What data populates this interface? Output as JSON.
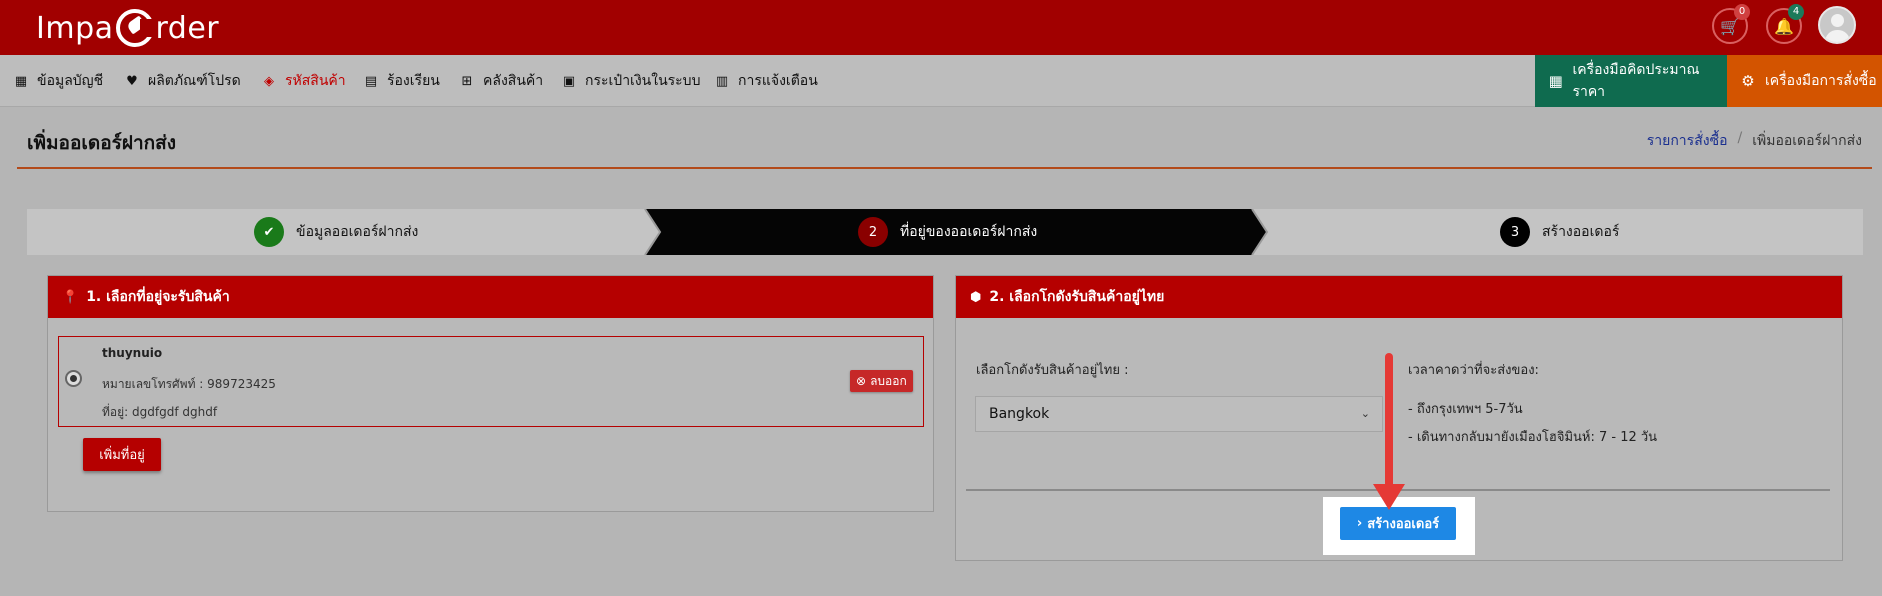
{
  "header": {
    "logo_text_left": "Impa",
    "logo_text_right": "rder",
    "cart_badge": "0",
    "notif_badge": "4",
    "colors": {
      "bar": "#a10000",
      "cart_badge": "#d04040",
      "notif_badge": "#1b7a5a"
    }
  },
  "nav": {
    "items": [
      {
        "label": "ข้อมูลบัญชี",
        "icon": "dashboard-icon"
      },
      {
        "label": "ผลิตภัณฑ์โปรด",
        "icon": "heart-icon"
      },
      {
        "label": "รหัสสินค้า",
        "icon": "layers-icon"
      },
      {
        "label": "ร้องเรียน",
        "icon": "comment-icon"
      },
      {
        "label": "คลังสินค้า",
        "icon": "warehouse-icon"
      },
      {
        "label": "กระเป๋าเงินในระบบ",
        "icon": "wallet-icon"
      },
      {
        "label": "การแจ้งเตือน",
        "icon": "book-icon"
      }
    ],
    "tools": [
      {
        "label": "เครื่องมือคิดประมาณราคา",
        "icon": "calculator-icon",
        "color": "#0f6b4f"
      },
      {
        "label": "เครื่องมือการสั่งซื้อ",
        "icon": "gear-icon",
        "color": "#d35400"
      }
    ]
  },
  "page": {
    "title": "เพิ่มออเดอร์ฝากส่ง",
    "breadcrumb_link": "รายการสั่งซื้อ",
    "breadcrumb_sep": "/",
    "breadcrumb_current": "เพิ่มออเดอร์ฝากส่ง"
  },
  "steps": [
    {
      "marker": "✔",
      "label": "ข้อมูลออเดอร์ฝากส่ง",
      "state": "done"
    },
    {
      "marker": "2",
      "label": "ที่อยู่ของออเดอร์ฝากส่ง",
      "state": "current"
    },
    {
      "marker": "3",
      "label": "สร้างออเดอร์",
      "state": "pending"
    }
  ],
  "address_panel": {
    "title": "1. เลือกที่อยู่จะรับสินค้า",
    "entry": {
      "name": "thuynuio",
      "phone": "หมายเลขโทรศัพท์ : 989723425",
      "address": "ที่อยู่: dgdfgdf dghdf"
    },
    "delete_label": "ลบออก",
    "add_label": "เพิ่มที่อยู่"
  },
  "warehouse_panel": {
    "title": "2. เลือกโกดังรับสินค้าอยู่ไทย",
    "select_label": "เลือกโกดังรับสินค้าอยู่ไทย :",
    "selected": "Bangkok",
    "eta_title": "เวลาคาดว่าที่จะส่งของ:",
    "eta_1": "- ถึงกรุงเทพฯ 5-7วัน",
    "eta_2": "- เดินทางกลับมายังเมืองโฮจิมินห์: 7 - 12 วัน",
    "create_label": "สร้างออเดอร์"
  }
}
